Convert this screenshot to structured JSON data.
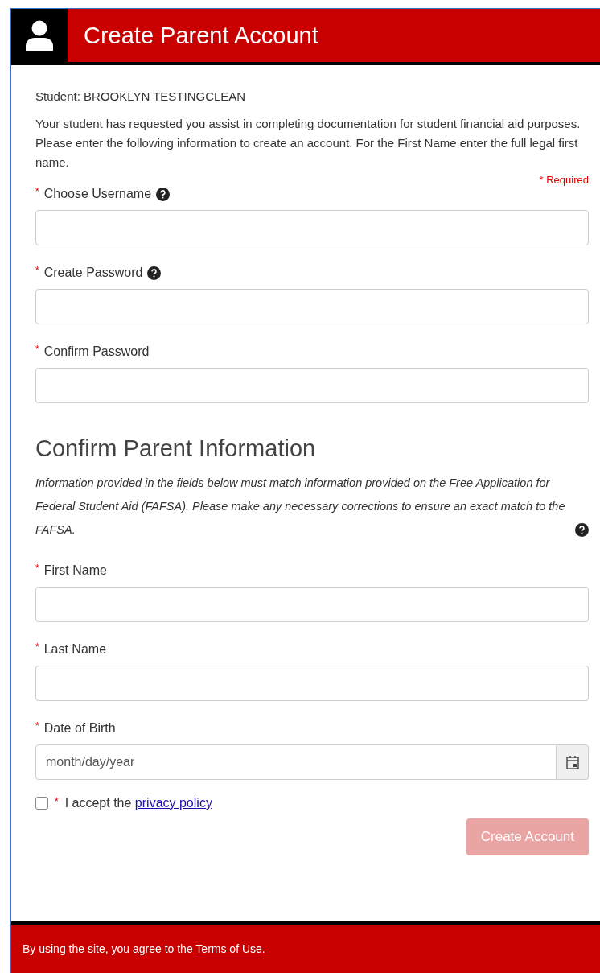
{
  "header": {
    "title": "Create Parent Account"
  },
  "required_mark": "*",
  "student": "Student: BROOKLYN TESTINGCLEAN",
  "intro": "Your student has requested you assist in completing documentation for student financial aid purposes. Please enter the following information to create an account. For the First Name enter the full legal first name.",
  "required_note": "Required",
  "account_fields": [
    {
      "label": "Choose Username",
      "kind": "text",
      "required": true,
      "help": true
    },
    {
      "label": "Create Password",
      "kind": "text",
      "required": true,
      "help": true
    },
    {
      "label": "Confirm Password",
      "kind": "text",
      "required": true,
      "help": false
    }
  ],
  "section": {
    "title": "Confirm Parent Information",
    "note": "Information provided in the fields below must match information provided on the Free Application for Federal Student Aid (FAFSA). Please make any necessary corrections to ensure an exact match to the FAFSA.",
    "help": true
  },
  "parent_fields": [
    {
      "label": "First Name",
      "kind": "text",
      "required": true,
      "help": false
    },
    {
      "label": "Last Name",
      "kind": "text",
      "required": true,
      "help": false
    },
    {
      "label": "Date of Birth",
      "kind": "date",
      "required": true,
      "help": false,
      "placeholder": "month/day/year"
    }
  ],
  "privacy": {
    "checked": false,
    "text": "I accept the",
    "link": "privacy policy"
  },
  "submit": {
    "label": "Create Account",
    "disabled": true
  },
  "footer": {
    "text": "By using the site, you agree to the",
    "link": "Terms of Use",
    "end": "."
  }
}
